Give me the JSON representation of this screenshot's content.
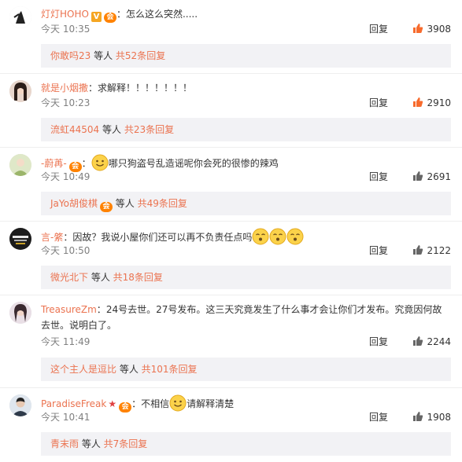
{
  "comments": [
    {
      "user": "灯灯HOHO",
      "sep": "：",
      "text": "怎么这么突然.....",
      "time": "今天 10:35",
      "reply": "回复",
      "likes": "3908",
      "sub_name": "你敢吗23",
      "sub_mid": " 等人 ",
      "sub_count": "共52条回复"
    },
    {
      "user": "就是小烟撒",
      "sep": "：",
      "text": "求解释！！！！！！！",
      "time": "今天 10:23",
      "reply": "回复",
      "likes": "2910",
      "sub_name": "流虹44504",
      "sub_mid": " 等人 ",
      "sub_count": "共23条回复"
    },
    {
      "user": "-蔚苒-",
      "sep": "：",
      "text": "哪只狗盗号乱造谣呢你会死的很惨的辣鸡",
      "time": "今天 10:49",
      "reply": "回复",
      "likes": "2691",
      "sub_name": "JaYo胡俊棋",
      "sub_mid": " 等人 ",
      "sub_count": "共49条回复"
    },
    {
      "user": "言-綮",
      "sep": "：",
      "text": "因故？我说小屋你们还可以再不负责任点吗",
      "time": "今天 10:50",
      "reply": "回复",
      "likes": "2122",
      "sub_name": "微光北下",
      "sub_mid": " 等人 ",
      "sub_count": "共18条回复"
    },
    {
      "user": "TreasureZm",
      "sep": "：",
      "text": "24号去世。27号发布。这三天究竟发生了什么事才会让你们才发布。究竟因何故去世。说明白了。",
      "time": "今天 11:49",
      "reply": "回复",
      "likes": "2244",
      "sub_name": "这个主人是逗比",
      "sub_mid": " 等人 ",
      "sub_count": "共101条回复"
    },
    {
      "user": "ParadiseFreak",
      "sep": "：",
      "text": "不相信",
      "text2": "请解释清楚",
      "time": "今天 10:41",
      "reply": "回复",
      "likes": "1908",
      "sub_name": "青末雨",
      "sub_mid": " 等人 ",
      "sub_count": "共7条回复"
    }
  ],
  "badges": {
    "verified": "V",
    "member": "会"
  },
  "icons": {
    "like": "thumbs-up-icon",
    "emoji": "smiley-emoji-icon",
    "star": "red-star-icon"
  },
  "colors": {
    "username": "#eb7350",
    "like_icon": "#f76b2d",
    "sub_bg": "#f2f2f5",
    "time": "#808080"
  }
}
